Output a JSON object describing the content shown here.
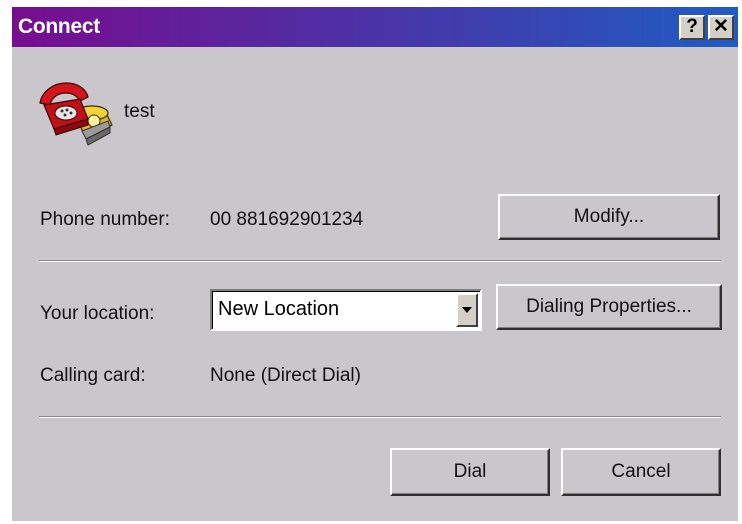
{
  "window": {
    "title": "Connect",
    "help_glyph": "?",
    "close_glyph": "✕"
  },
  "entry": {
    "name": "test",
    "icon": "telephone-icon"
  },
  "phone": {
    "label": "Phone number:",
    "value": "00 881692901234",
    "modify_label": "Modify..."
  },
  "location": {
    "label": "Your location:",
    "selected": "New Location",
    "dialing_properties_label": "Dialing Properties..."
  },
  "calling_card": {
    "label": "Calling card:",
    "value": "None (Direct Dial)"
  },
  "actions": {
    "dial_label": "Dial",
    "cancel_label": "Cancel"
  },
  "colors": {
    "dialog_bg": "#c9c7cb",
    "title_gradient_start": "#770d8f",
    "title_gradient_end": "#1f5cc2",
    "phone_red": "#d4161c",
    "phone_yellow": "#f0d23a"
  }
}
